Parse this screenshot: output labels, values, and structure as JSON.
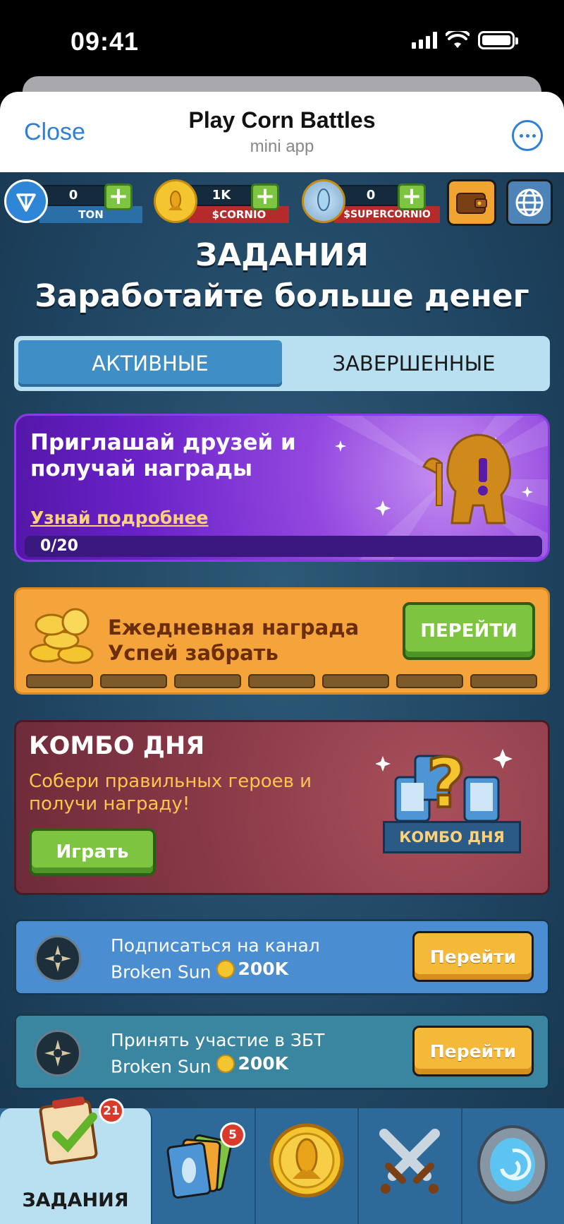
{
  "status_bar": {
    "time": "09:41"
  },
  "header": {
    "close_label": "Close",
    "title": "Play Corn Battles",
    "subtitle": "mini app"
  },
  "currencies": [
    {
      "name": "TON",
      "amount": "0"
    },
    {
      "name": "$CORNIO",
      "amount": "1K"
    },
    {
      "name": "$SUPERCORNIO",
      "amount": "0"
    }
  ],
  "page": {
    "heading": "ЗАДАНИЯ",
    "subheading": "Заработайте больше денег"
  },
  "tabs": [
    {
      "label": "АКТИВНЫЕ",
      "active": true
    },
    {
      "label": "ЗАВЕРШЕННЫЕ",
      "active": false
    }
  ],
  "referral": {
    "title": "Приглашай друзей и получай награды",
    "link": "Узнай подробнее",
    "progress_text": "0/20",
    "progress": 0
  },
  "daily": {
    "title_line1": "Ежедневная награда",
    "title_line2": "Успей забрать",
    "button": "ПЕРЕЙТИ",
    "slots": 7
  },
  "combo": {
    "title": "КОМБО ДНЯ",
    "description": "Собери правильных героев и получи награду!",
    "button": "Играть",
    "ribbon": "КОМБО ДНЯ"
  },
  "tasks": [
    {
      "text": "Подписаться на канал Broken Sun",
      "reward": "200K",
      "button": "Перейти"
    },
    {
      "text": "Принять участие в ЗБТ Broken Sun",
      "reward": "200K",
      "button": "Перейти"
    }
  ],
  "nav": {
    "tasks_label": "ЗАДАНИЯ",
    "tasks_badge": "21",
    "cards_badge": "5"
  },
  "colors": {
    "accent": "#2f7fd6",
    "app_bg": "#1f4461",
    "green_button": "#7dc441",
    "orange_card": "#f4a43b",
    "purple_card": "#7a2ed6"
  }
}
